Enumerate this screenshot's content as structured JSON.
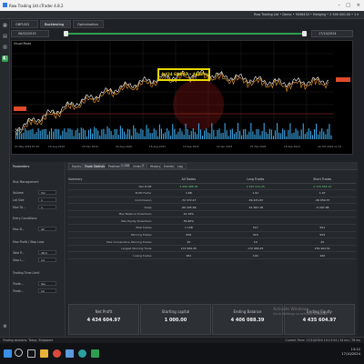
{
  "window": {
    "title": "Raw Trading Ltd cTrader 4.8.2",
    "controls": [
      "–",
      "□",
      "×"
    ]
  },
  "topbar": {
    "account_info": "Raw Trading Ltd • Demo • 9056433 • Hedging • 2 500 000.00 •  1 ▾"
  },
  "sidebar": {
    "buttons": [
      "grid-icon",
      "chart-icon",
      "calendar-icon",
      "robot-icon",
      "settings-icon"
    ]
  },
  "tabs": {
    "symbol_tab": "GBPUSD",
    "backtesting_tab": "Backtesting",
    "optimisation_tab": "Optimisation"
  },
  "dates": {
    "start": "06/02/2019",
    "end": "17/10/2024"
  },
  "chart": {
    "label": "Visual Mode",
    "highlight_value": "4 434 604.97 • 4466%",
    "axis_dates": [
      "07 May 2019 07:25",
      "19 Aug 2019",
      "20 Dec 2019",
      "19 Aug 2020",
      "18 Aug 2021",
      "10 Sep 2021",
      "14 Apr 2023",
      "21 Feb 2024",
      "18 Sep 2024",
      "14 Oct 2024 11:14"
    ],
    "colors": {
      "balance": "#ffffff",
      "equity": "#d98c2a",
      "volume": "#3aa6e6",
      "grid": "#202020"
    }
  },
  "parameters": {
    "title": "Parameters",
    "section_risk": "Risk Management",
    "rows": [
      {
        "label": "Volume",
        "value": "Vol"
      },
      {
        "label": "Lot Size",
        "value": "1"
      },
      {
        "label": "Max Ta...",
        "value": "1"
      }
    ],
    "section_entry": "Entry Conditions",
    "rows2": [
      {
        "label": "Max D...",
        "value": "42"
      }
    ],
    "section_daily": "Max Profit / Stop Loss",
    "rows3": [
      {
        "label": "Take P...",
        "value": "48.4"
      },
      {
        "label": "Stop L...",
        "value": "14"
      }
    ],
    "section_time": "Trading Time Limit",
    "rows4": [
      {
        "label": "Trade...",
        "value": "Yes"
      },
      {
        "label": "Trade...",
        "value": "12"
      }
    ]
  },
  "results": {
    "tabs": [
      "Equity",
      "Trade Statistics",
      "Positions",
      "Orders",
      "History",
      "Events",
      "Log"
    ],
    "active_tab": "Trade Statistics",
    "tab_badges": [
      "1 108",
      "1"
    ],
    "headers": [
      "Summary",
      "All Trades",
      "Long Trades",
      "Short Trades"
    ],
    "rows": [
      {
        "label": "Net Profit",
        "all": "4 406 088.39",
        "long": "2 225 913.25",
        "short": "2 179 565.13",
        "cls": "green"
      },
      {
        "label": "Profit Factor",
        "all": "1.68",
        "long": "1.91",
        "short": "1.47",
        "cls": ""
      },
      {
        "label": "Commission",
        "all": "-72 372.47",
        "long": "-36 431.63",
        "short": "-36 059.37",
        "cls": ""
      },
      {
        "label": "Swap",
        "all": "-66 295.96",
        "long": "-31 997.18",
        "short": "-5 297.98",
        "cls": ""
      },
      {
        "label": "Max Balance Drawdown",
        "all": "21.19%",
        "long": "",
        "short": "",
        "cls": ""
      },
      {
        "label": "Max Equity Drawdown",
        "all": "35.60%",
        "long": "",
        "short": "",
        "cls": ""
      },
      {
        "label": "Total trades",
        "all": "1 108",
        "long": "517",
        "short": "591",
        "cls": ""
      },
      {
        "label": "Winning Trades",
        "all": "876",
        "long": "315",
        "short": "553",
        "cls": ""
      },
      {
        "label": "Max Consecutive Winning Trades",
        "all": "30",
        "long": "14",
        "short": "25",
        "cls": ""
      },
      {
        "label": "Largest Winning Trade",
        "all": "172 956.25",
        "long": "172 956.25",
        "short": "159 402.51",
        "cls": ""
      },
      {
        "label": "Losing trades",
        "all": "261",
        "long": "104",
        "short": "160",
        "cls": ""
      }
    ],
    "summary": [
      {
        "label": "Net Profit",
        "value": "4 434 604.97"
      },
      {
        "label": "Starting capital",
        "value": "1 000.00"
      },
      {
        "label": "Ending Balance",
        "value": "4 406 088.39"
      },
      {
        "label": "Ending Equity",
        "value": "4 435 604.97"
      }
    ]
  },
  "watermark": {
    "line1": "Activate Windows",
    "line2": "Go to Settings to activate Windows."
  },
  "statusbar": {
    "left": "Trading sessions: Tokyo, Singapore",
    "right": "Current Time: 17/10/2024 10:13:54 | 34 ms / 78 ms"
  },
  "taskbar": {
    "time": "13:12",
    "date": "17/10/2024",
    "icons": [
      "windows-icon",
      "search-icon",
      "taskview-icon",
      "explorer-icon",
      "chrome-icon",
      "store-icon",
      "edge-icon",
      "ctrader-icon"
    ]
  }
}
